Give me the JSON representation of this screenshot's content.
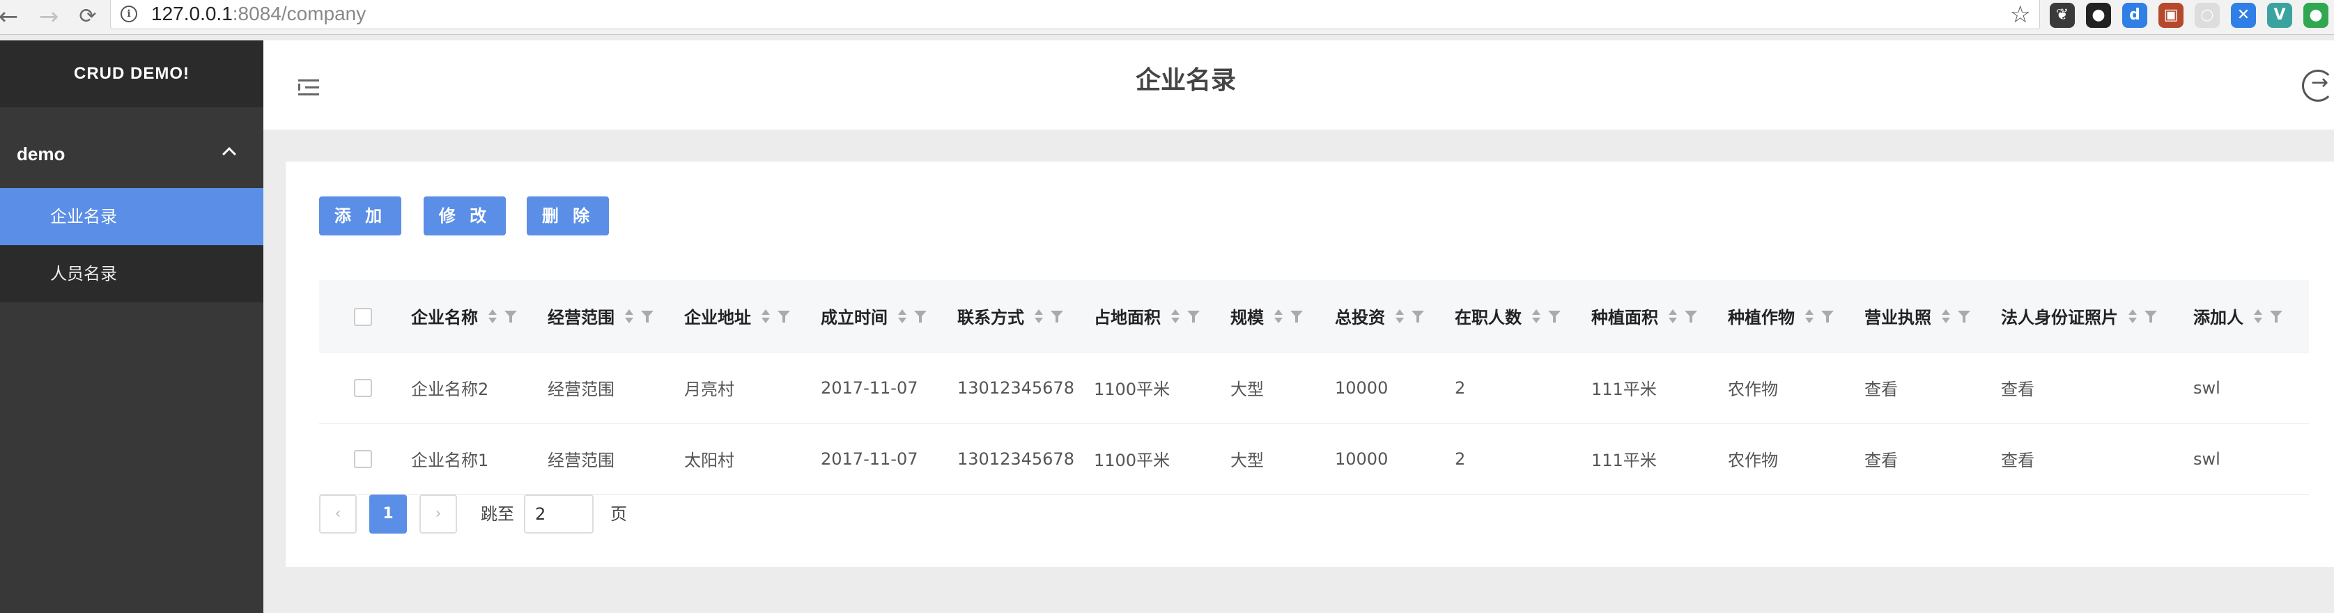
{
  "browser": {
    "url_host": "127.0.0.1",
    "url_rest": ":8084/company",
    "back": "←",
    "forward": "→",
    "reload": "⟳",
    "star": "☆",
    "extensions": [
      {
        "icon": "evernote-icon",
        "color": "#3a3a3a",
        "glyph": "❦"
      },
      {
        "icon": "record-icon",
        "color": "#222222",
        "glyph": "●"
      },
      {
        "icon": "dict-icon",
        "color": "#2f7fe6",
        "glyph": "d"
      },
      {
        "icon": "photo-icon",
        "color": "#b5492b",
        "glyph": "▣"
      },
      {
        "icon": "ghost-icon",
        "color": "#dddddd",
        "glyph": "○"
      },
      {
        "icon": "compass-icon",
        "color": "#2f7fe6",
        "glyph": "✕"
      },
      {
        "icon": "vue-icon",
        "color": "#3aa3a0",
        "glyph": "V"
      },
      {
        "icon": "green-dot-icon",
        "color": "#2fa84f",
        "glyph": "●"
      }
    ]
  },
  "sidebar": {
    "logo": "CRUD DEMO!",
    "group_label": "demo",
    "items": [
      {
        "label": "企业名录",
        "active": true
      },
      {
        "label": "人员名录",
        "active": false
      }
    ]
  },
  "header": {
    "title": "企业名录"
  },
  "toolbar": {
    "add_label": "添 加",
    "edit_label": "修 改",
    "delete_label": "删 除"
  },
  "table": {
    "columns": [
      "企业名称",
      "经营范围",
      "企业地址",
      "成立时间",
      "联系方式",
      "占地面积",
      "规模",
      "总投资",
      "在职人数",
      "种植面积",
      "种植作物",
      "营业执照",
      "法人身份证照片",
      "添加人"
    ],
    "rows": [
      [
        "企业名称2",
        "经营范围",
        "月亮村",
        "2017-11-07",
        "13012345678",
        "1100平米",
        "大型",
        "10000",
        "2",
        "111平米",
        "农作物",
        "查看",
        "查看",
        "swl"
      ],
      [
        "企业名称1",
        "经营范围",
        "太阳村",
        "2017-11-07",
        "13012345678",
        "1100平米",
        "大型",
        "10000",
        "2",
        "111平米",
        "农作物",
        "查看",
        "查看",
        "swl"
      ]
    ]
  },
  "pagination": {
    "prev": "‹",
    "current": "1",
    "next": "›",
    "jump_label": "跳至",
    "jump_value": "2",
    "page_label": "页"
  }
}
